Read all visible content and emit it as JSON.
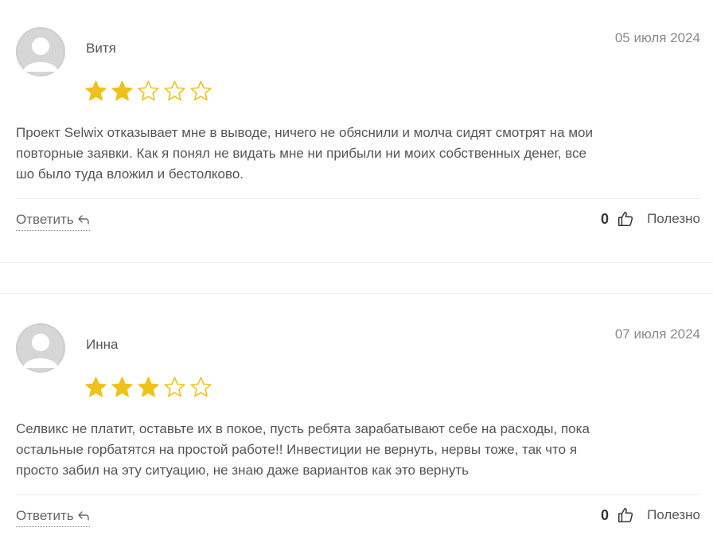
{
  "reviews": [
    {
      "name": "Витя",
      "date": "05 июля 2024",
      "rating": 2,
      "max_rating": 5,
      "text_lines": [
        "Проект Selwix отказывает мне в выводе, ничего не обяснили и молча сидят смотрят на мои",
        "повторные заявки. Как я понял не видать мне ни прибыли ни моих собственных денег, все",
        "шо было туда вложил и бестолково."
      ],
      "reply_label": "Ответить",
      "likes": "0",
      "useful_label": "Полезно"
    },
    {
      "name": "Инна",
      "date": "07 июля 2024",
      "rating": 3,
      "max_rating": 5,
      "text_lines": [
        "Селвикс не платит, оставьте их в покое, пусть ребята зарабатывают себе на расходы, пока",
        "остальные горбатятся на простой работе!! Инвестиции не вернуть, нервы тоже, так что я",
        "просто забил на эту ситуацию, не знаю даже вариантов как это вернуть"
      ],
      "reply_label": "Ответить",
      "likes": "0",
      "useful_label": "Полезно"
    }
  ],
  "colors": {
    "star_filled": "#EFC21A",
    "star_empty_stroke": "#EFC21A",
    "avatar_bg": "#d6d6d6"
  },
  "icons": {
    "avatar": "user-placeholder-icon",
    "reply": "reply-arrow-icon",
    "thumb": "thumbs-up-icon",
    "star": "star-icon"
  }
}
